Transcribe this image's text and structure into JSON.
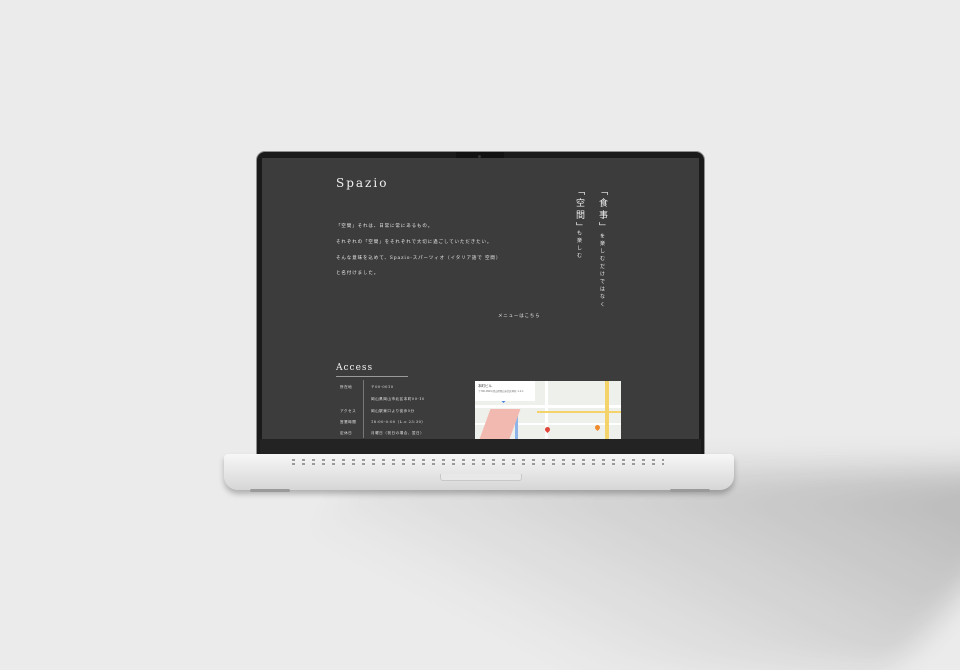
{
  "site": {
    "logo": "Spazio",
    "intro": [
      "「空間」それは、日常に常にあるもの。",
      "それぞれの「空間」をそれぞれで大切に過ごしていただきたい。",
      "そんな意味を込めて、Spazio-スパーツィオ（イタリア語で 空間）",
      "と名付けました。"
    ],
    "menu_link": "メニューはこちら",
    "tagline": {
      "col1_big": "「食事」",
      "col1_small": "を楽しむだけではなく",
      "col2_big": "「空間」",
      "col2_small": "も楽しむ"
    }
  },
  "access": {
    "title": "Access",
    "rows": [
      {
        "label": "所在地",
        "value": "〒00-0010"
      },
      {
        "label": "",
        "value": "岡山県岡山市北区本町00-10"
      },
      {
        "label": "アクセス",
        "value": "岡山駅東口より徒歩5分"
      },
      {
        "label": "営業時間",
        "value": "18:00-0:00（L.o 23:30）"
      },
      {
        "label": "定休日",
        "value": "月曜日（祝日の場合、翌日）"
      }
    ],
    "map": {
      "place_name": "本町ビル",
      "place_address": "〒700-0901 岡山県岡山市北区本町 1-1-1"
    }
  },
  "colors": {
    "screen_bg": "#3c3c3c",
    "text": "#f0f0f0",
    "backdrop": "#ebebeb"
  }
}
